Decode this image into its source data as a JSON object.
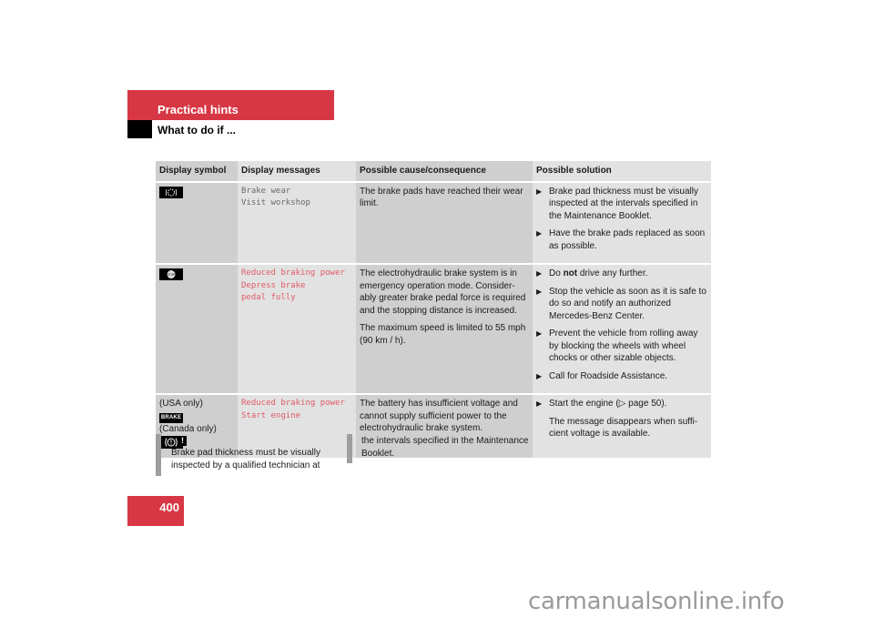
{
  "header": {
    "section_title": "Practical hints",
    "sub_title": "What to do if ..."
  },
  "table": {
    "columns": [
      "Display symbol",
      "Display messages",
      "Possible cause/consequence",
      "Possible solution"
    ],
    "rows": [
      {
        "symbol_icon": "brake-wear-icon",
        "symbol_labels": [],
        "messages": [
          "Brake wear",
          "Visit workshop"
        ],
        "message_color": "grey",
        "cause": [
          "The brake pads have reached their wear limit."
        ],
        "solution": [
          {
            "type": "bullet",
            "text": "Brake pad thickness must be visually inspected at the intervals specified in the Maintenance Booklet."
          },
          {
            "type": "bullet",
            "text": "Have the brake pads replaced as soon as possible."
          }
        ]
      },
      {
        "symbol_icon": "stop-icon",
        "symbol_labels": [],
        "messages": [
          "Reduced braking power",
          "Depress brake",
          "pedal fully"
        ],
        "message_color": "red",
        "cause": [
          "The electrohydraulic brake system is in emergency operation mode. Consider-ably greater brake pedal force is required and the stopping distance is increased.",
          "The maximum speed is limited to 55 mph (90 km / h)."
        ],
        "solution": [
          {
            "type": "bullet",
            "pre": "Do ",
            "bold": "not",
            "post": " drive any further."
          },
          {
            "type": "bullet",
            "text": "Stop the vehicle as soon as it is safe to do so and notify an authorized Mercedes-Benz Center."
          },
          {
            "type": "bullet",
            "text": "Prevent the vehicle from rolling away by blocking the wheels with wheel chocks or other sizable objects."
          },
          {
            "type": "bullet",
            "text": "Call for Roadside Assistance."
          }
        ]
      },
      {
        "symbol_labels": [
          "(USA only)",
          "(Canada only)"
        ],
        "symbol_icons": [
          "brake-text-icon",
          "parking-brake-icon"
        ],
        "brake_icon_text": "BRAKE",
        "park_icon_text": "(Ⓘ)",
        "messages": [
          "Reduced braking power",
          "Start engine"
        ],
        "message_color": "red",
        "cause": [
          "The battery has insufficient voltage and cannot supply sufficient power to the electrohydraulic brake system."
        ],
        "solution": [
          {
            "type": "bullet",
            "text": "Start the engine (▷ page 50)."
          },
          {
            "type": "plain",
            "text": "The message disappears when suffi-cient voltage is available."
          }
        ]
      }
    ]
  },
  "note": {
    "icon": "!",
    "text_col1": "Brake pad thickness must be visually inspected by a qualified technician at",
    "text_col2": "the intervals specified in the Maintenance Booklet."
  },
  "footer": {
    "page_number": "400",
    "watermark": "carmanualsonline.info"
  },
  "colors": {
    "brand_red": "#d73744",
    "message_red": "#e05a64",
    "message_grey": "#6a6a6a"
  }
}
